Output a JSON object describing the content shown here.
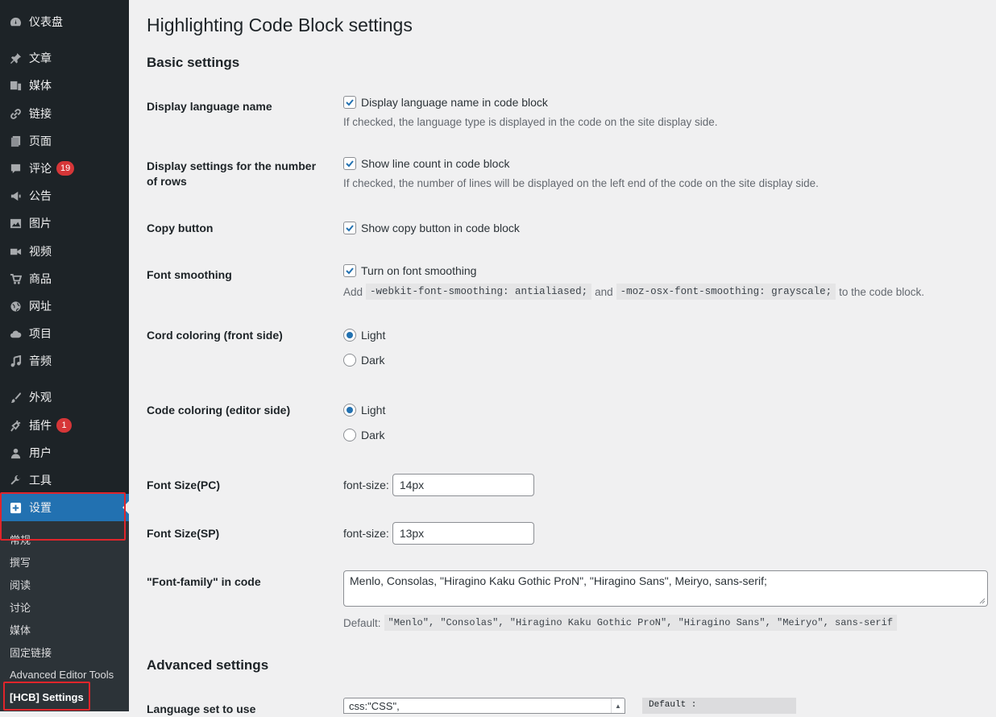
{
  "sidebar": {
    "items": [
      {
        "label": "仪表盘",
        "icon": "dashboard-icon"
      },
      {
        "label": "文章",
        "icon": "pin-icon"
      },
      {
        "label": "媒体",
        "icon": "media-icon"
      },
      {
        "label": "链接",
        "icon": "link-icon"
      },
      {
        "label": "页面",
        "icon": "page-icon"
      },
      {
        "label": "评论",
        "icon": "comment-icon",
        "badge": "19"
      },
      {
        "label": "公告",
        "icon": "megaphone-icon"
      },
      {
        "label": "图片",
        "icon": "image-icon"
      },
      {
        "label": "视频",
        "icon": "video-icon"
      },
      {
        "label": "商品",
        "icon": "cart-icon"
      },
      {
        "label": "网址",
        "icon": "globe-icon"
      },
      {
        "label": "项目",
        "icon": "cloud-icon"
      },
      {
        "label": "音频",
        "icon": "music-icon"
      },
      {
        "label": "外观",
        "icon": "brush-icon"
      },
      {
        "label": "插件",
        "icon": "plugin-icon",
        "badge": "1"
      },
      {
        "label": "用户",
        "icon": "user-icon"
      },
      {
        "label": "工具",
        "icon": "wrench-icon"
      },
      {
        "label": "设置",
        "icon": "settings-icon"
      }
    ],
    "submenu": [
      "常规",
      "撰写",
      "阅读",
      "讨论",
      "媒体",
      "固定链接",
      "Advanced Editor Tools",
      "[HCB] Settings"
    ]
  },
  "page": {
    "title": "Highlighting Code Block settings",
    "basic_title": "Basic settings",
    "advanced_title": "Advanced settings"
  },
  "settings": {
    "lang_name": {
      "label": "Display language name",
      "check_label": "Display language name in code block",
      "desc": "If checked, the language type is displayed in the code on the site display side."
    },
    "rows": {
      "label": "Display settings for the number of rows",
      "check_label": "Show line count in code block",
      "desc": "If checked, the number of lines will be displayed on the left end of the code on the site display side."
    },
    "copy": {
      "label": "Copy button",
      "check_label": "Show copy button in code block"
    },
    "smoothing": {
      "label": "Font smoothing",
      "check_label": "Turn on font smoothing",
      "desc_prefix": "Add",
      "code1": "-webkit-font-smoothing: antialiased;",
      "desc_mid": "and",
      "code2": "-moz-osx-font-smoothing: grayscale;",
      "desc_suffix": "to the code block."
    },
    "front_coloring": {
      "label": "Cord coloring (front side)",
      "options": [
        "Light",
        "Dark"
      ],
      "selected": "Light"
    },
    "editor_coloring": {
      "label": "Code coloring (editor side)",
      "options": [
        "Light",
        "Dark"
      ],
      "selected": "Light"
    },
    "font_size_pc": {
      "label": "Font Size(PC)",
      "prefix": "font-size:",
      "value": "14px"
    },
    "font_size_sp": {
      "label": "Font Size(SP)",
      "prefix": "font-size:",
      "value": "13px"
    },
    "font_family": {
      "label": "\"Font-family\" in code",
      "value": "Menlo, Consolas, \"Hiragino Kaku Gothic ProN\", \"Hiragino Sans\", Meiryo, sans-serif;",
      "default_prefix": "Default:",
      "default_value": "\"Menlo\", \"Consolas\", \"Hiragino Kaku Gothic ProN\", \"Hiragino Sans\", \"Meiryo\", sans-serif"
    },
    "language_set": {
      "label": "Language set to use",
      "value": "css:\"CSS\",",
      "default_label": "Default :"
    }
  },
  "colors": {
    "accent": "#2271b1",
    "sidebar_bg": "#1d2327",
    "highlight_box": "#e0252b",
    "badge": "#d63638"
  }
}
